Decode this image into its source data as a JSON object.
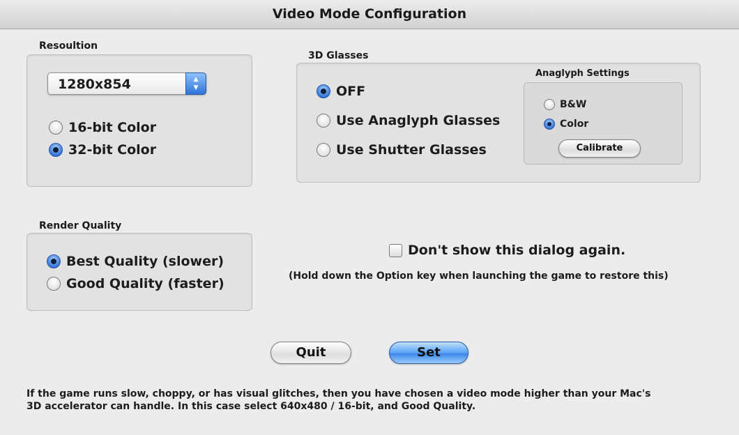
{
  "window": {
    "title": "Video Mode Configuration"
  },
  "resolution": {
    "label": "Resoultion",
    "selected": "1280x854",
    "options": [
      {
        "label": "16-bit Color",
        "checked": false
      },
      {
        "label": "32-bit Color",
        "checked": true
      }
    ]
  },
  "glasses": {
    "label": "3D Glasses",
    "options": [
      {
        "label": "OFF",
        "checked": true
      },
      {
        "label": "Use Anaglyph Glasses",
        "checked": false
      },
      {
        "label": "Use Shutter Glasses",
        "checked": false
      }
    ],
    "anaglyph": {
      "label": "Anaglyph Settings",
      "options": [
        {
          "label": "B&W",
          "checked": false
        },
        {
          "label": "Color",
          "checked": true
        }
      ],
      "calibrate_label": "Calibrate"
    }
  },
  "render": {
    "label": "Render Quality",
    "options": [
      {
        "label": "Best Quality (slower)",
        "checked": true
      },
      {
        "label": "Good Quality (faster)",
        "checked": false
      }
    ]
  },
  "dialog_option": {
    "label": "Don't show this dialog again.",
    "checked": false,
    "note": "(Hold down the Option key when launching the game to restore this)"
  },
  "buttons": {
    "quit": "Quit",
    "set": "Set"
  },
  "footer": {
    "line1": "If the game runs slow, choppy, or has visual glitches, then you have chosen a video mode higher than your Mac's",
    "line2": "3D accelerator can handle.   In this case select 640x480 / 16-bit, and Good Quality."
  },
  "colors": {
    "accent": "#3b86e8",
    "window_bg": "#ececec",
    "group_bg": "#e2e2e2"
  }
}
